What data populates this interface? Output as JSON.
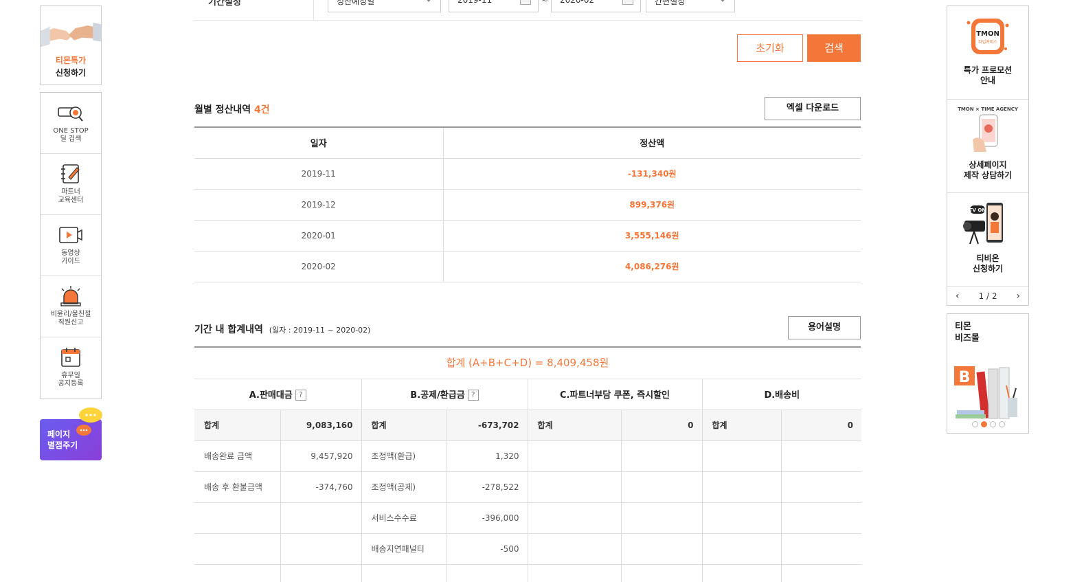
{
  "colors": {
    "accent": "#f4773a",
    "promo_gradient": [
      "#6a5df0",
      "#8a3ed8"
    ]
  },
  "left_sidebar": {
    "promo": {
      "line1": "티몬특가",
      "line2": "신청하기",
      "icon": "handshake-icon"
    },
    "menu": [
      {
        "label": "ONE STOP\n딜 검색",
        "icon": "search-deal-icon"
      },
      {
        "label": "파트너\n교육센터",
        "icon": "notebook-pen-icon"
      },
      {
        "label": "동영상\n가이드",
        "icon": "video-icon"
      },
      {
        "label": "비윤리/불친절\n직원신고",
        "icon": "siren-icon"
      },
      {
        "label": "휴무일\n공지등록",
        "icon": "calendar-icon"
      }
    ],
    "rate_button": {
      "line1": "페이지",
      "line2": "별점주기"
    }
  },
  "filter": {
    "label": "기간설정",
    "type_select": "정산예정일",
    "start_date": "2019-11",
    "tilde": "~",
    "end_date": "2020-02",
    "quick_select": "간편설정"
  },
  "buttons": {
    "reset": "초기화",
    "search": "검색",
    "excel": "엑셀 다운로드",
    "glossary": "용어설명"
  },
  "monthly": {
    "title": "월별 정산내역",
    "count": "4건",
    "headers": [
      "일자",
      "정산액"
    ],
    "rows": [
      {
        "date": "2019-11",
        "amount": "-131,340원"
      },
      {
        "date": "2019-12",
        "amount": "899,376원"
      },
      {
        "date": "2020-01",
        "amount": "3,555,146원"
      },
      {
        "date": "2020-02",
        "amount": "4,086,276원"
      }
    ]
  },
  "period_summary": {
    "title": "기간 내 합계내역",
    "subtitle": "(일자 : 2019-11 ~ 2020-02)",
    "total_line": "합계 (A+B+C+D) = 8,409,458원",
    "headers": {
      "a": "A.판매대금",
      "b": "B.공제/환급금",
      "c": "C.파트너부담 쿠폰, 즉시할인",
      "d": "D.배송비",
      "help": "?"
    },
    "rows": [
      [
        "합계",
        "9,083,160",
        "합계",
        "-673,702",
        "합계",
        "0",
        "합계",
        "0"
      ],
      [
        "배송완료 금액",
        "9,457,920",
        "조정액(환급)",
        "1,320",
        "",
        "",
        "",
        ""
      ],
      [
        "배송 후 환불금액",
        "-374,760",
        "조정액(공제)",
        "-278,522",
        "",
        "",
        "",
        ""
      ],
      [
        "",
        "",
        "서비스수수료",
        "-396,000",
        "",
        "",
        "",
        ""
      ],
      [
        "",
        "",
        "배송지연패널티",
        "-500",
        "",
        "",
        "",
        ""
      ],
      [
        "",
        "",
        "",
        "",
        "",
        "",
        "",
        ""
      ]
    ]
  },
  "right_sidebar": {
    "items": [
      {
        "label": "특가 프로모션\n안내",
        "icon": "tmon-timecommerce-logo",
        "logo_text": "TMON",
        "logo_sub": "타임커머스"
      },
      {
        "label": "상세페이지\n제작 상담하기",
        "icon": "phone-hand-icon",
        "banner_text": "TMON × TIME AGENCY"
      },
      {
        "label": "티비온\n신청하기",
        "icon": "camera-tvon-icon",
        "badge_text": "TV ON"
      }
    ],
    "pager": "1 / 2"
  },
  "bizmall": {
    "title": "티몬\n비즈몰",
    "logo": "B"
  }
}
